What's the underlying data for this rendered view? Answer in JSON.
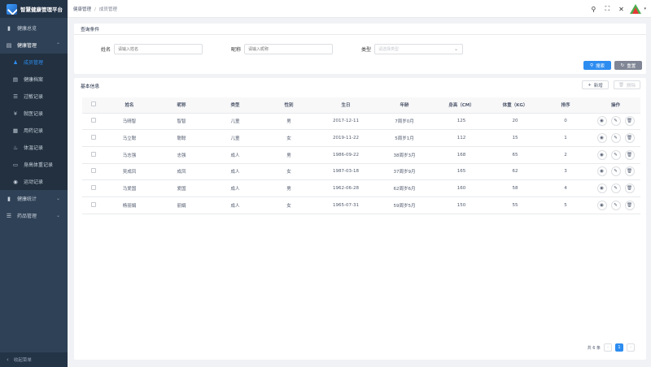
{
  "brand": {
    "name": "智慧健康管理平台"
  },
  "sidebar": {
    "items": [
      {
        "label": "健康总览",
        "icon": "chart-icon",
        "glyph": "▮"
      },
      {
        "label": "健康管理",
        "icon": "file-icon",
        "glyph": "▤",
        "chevron": "⌃"
      }
    ],
    "subitems": [
      {
        "label": "成员管理",
        "icon": "user-icon",
        "glyph": "♟"
      },
      {
        "label": "健康档案",
        "icon": "record-icon",
        "glyph": "▤"
      },
      {
        "label": "过敏记录",
        "icon": "list-icon",
        "glyph": "☰"
      },
      {
        "label": "就医记录",
        "icon": "yen-icon",
        "glyph": "¥"
      },
      {
        "label": "用药记录",
        "icon": "calendar-icon",
        "glyph": "▦"
      },
      {
        "label": "体温记录",
        "icon": "thermo-icon",
        "glyph": "♨"
      },
      {
        "label": "身高体重记录",
        "icon": "scale-icon",
        "glyph": "▭"
      },
      {
        "label": "运动记录",
        "icon": "eye-icon",
        "glyph": "◉"
      }
    ],
    "bottom_items": [
      {
        "label": "健康统计",
        "icon": "stats-icon",
        "glyph": "▮",
        "chevron": "⌄"
      },
      {
        "label": "药品管理",
        "icon": "menu-icon",
        "glyph": "☰",
        "chevron": "⌄"
      }
    ],
    "collapse_label": "收起菜单"
  },
  "breadcrumb": {
    "first": "健康管理",
    "sep": "/",
    "current": "成员管理"
  },
  "header": {
    "search": "⚲",
    "fullscreen": "⛶",
    "close": "✕",
    "caret": "▾"
  },
  "query": {
    "title": "查询条件",
    "name_label": "姓名",
    "name_placeholder": "请输入姓名",
    "nick_label": "昵称",
    "nick_placeholder": "请输入昵称",
    "type_label": "类型",
    "type_placeholder": "请选择类型",
    "search_button": "搜索",
    "reset_button": "重置"
  },
  "table": {
    "title": "基本信息",
    "add_button": "新增",
    "delete_button": "删除",
    "columns": [
      "姓名",
      "昵称",
      "类型",
      "性别",
      "生日",
      "年龄",
      "身高（CM）",
      "体重（KG）",
      "排序",
      "操作"
    ],
    "rows": [
      {
        "name": "马晴智",
        "nick": "智智",
        "type": "儿童",
        "gender": "男",
        "birthday": "2017-12-11",
        "age": "7周岁0月",
        "height": "125",
        "weight": "20",
        "order": "0"
      },
      {
        "name": "马立聪",
        "nick": "聪聪",
        "type": "儿童",
        "gender": "女",
        "birthday": "2019-11-22",
        "age": "5周岁1月",
        "height": "112",
        "weight": "15",
        "order": "1"
      },
      {
        "name": "马志强",
        "nick": "志强",
        "type": "成人",
        "gender": "男",
        "birthday": "1986-09-22",
        "age": "38周岁3月",
        "height": "168",
        "weight": "65",
        "order": "2"
      },
      {
        "name": "吴成凤",
        "nick": "成凤",
        "type": "成人",
        "gender": "女",
        "birthday": "1987-03-18",
        "age": "37周岁9月",
        "height": "165",
        "weight": "62",
        "order": "3"
      },
      {
        "name": "马爱国",
        "nick": "爱国",
        "type": "成人",
        "gender": "男",
        "birthday": "1962-06-28",
        "age": "62周岁6月",
        "height": "160",
        "weight": "58",
        "order": "4"
      },
      {
        "name": "杨丽娟",
        "nick": "丽娟",
        "type": "成人",
        "gender": "女",
        "birthday": "1965-07-31",
        "age": "59周岁5月",
        "height": "150",
        "weight": "55",
        "order": "5"
      }
    ],
    "actions": {
      "view": "◉",
      "edit": "✎",
      "delete": "🗑"
    }
  },
  "pagination": {
    "total": "共 6 条",
    "prev": "‹",
    "page": "1",
    "next": "›"
  },
  "colors": {
    "accent": "#2d8cf0",
    "sidebar_bg": "#2f4156"
  }
}
